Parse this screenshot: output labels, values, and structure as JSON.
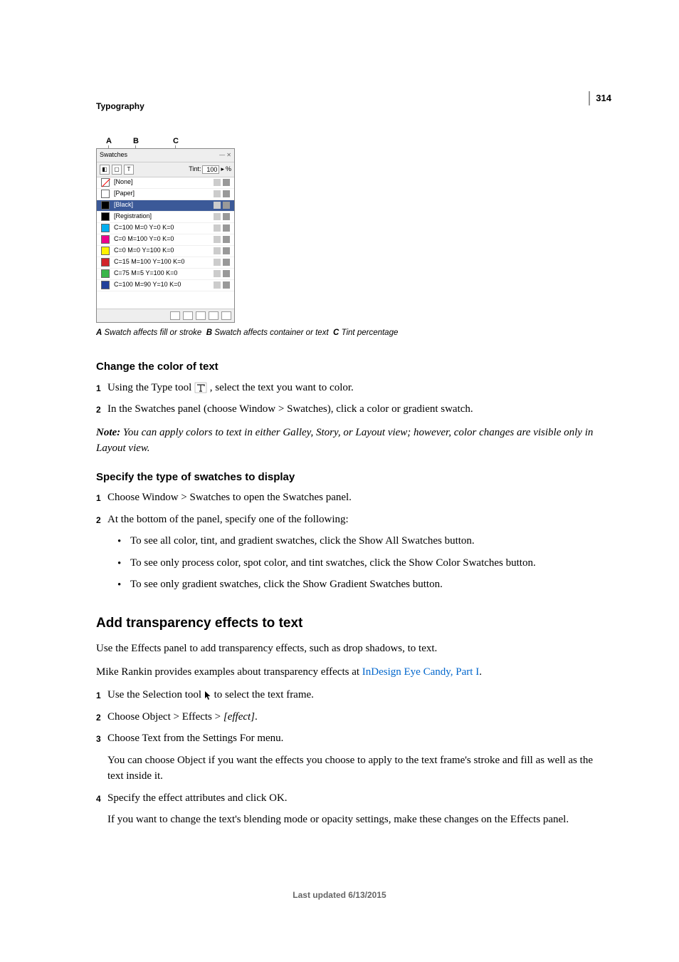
{
  "page_number": "314",
  "chapter": "Typography",
  "panel": {
    "labels": {
      "a": "A",
      "b": "B",
      "c": "C"
    },
    "tab": "Swatches",
    "tint_label": "Tint:",
    "tint_value": "100",
    "tint_unit": "%",
    "rows": [
      {
        "name": "[None]",
        "color": "transparent",
        "none": true,
        "sel": false
      },
      {
        "name": "[Paper]",
        "color": "#ffffff",
        "sel": false
      },
      {
        "name": "[Black]",
        "color": "#000000",
        "sel": true
      },
      {
        "name": "[Registration]",
        "color": "#000000",
        "sel": false
      },
      {
        "name": "C=100 M=0 Y=0 K=0",
        "color": "#00aeef",
        "sel": false
      },
      {
        "name": "C=0 M=100 Y=0 K=0",
        "color": "#ec008c",
        "sel": false
      },
      {
        "name": "C=0 M=0 Y=100 K=0",
        "color": "#fff200",
        "sel": false
      },
      {
        "name": "C=15 M=100 Y=100 K=0",
        "color": "#d2232a",
        "sel": false
      },
      {
        "name": "C=75 M=5 Y=100 K=0",
        "color": "#39b54a",
        "sel": false
      },
      {
        "name": "C=100 M=90 Y=10 K=0",
        "color": "#21409a",
        "sel": false
      }
    ]
  },
  "caption": {
    "a_label": "A",
    "a_text": "Swatch affects fill or stroke",
    "b_label": "B",
    "b_text": "Swatch affects container or text",
    "c_label": "C",
    "c_text": "Tint percentage"
  },
  "s1": {
    "heading": "Change the color of text",
    "step1_pre": "Using the Type tool ",
    "step1_post": " , select the text you want to color.",
    "step2": "In the Swatches panel (choose Window > Swatches), click a color or gradient swatch.",
    "note_label": "Note:",
    "note_body": " You can apply colors to text in either Galley, Story, or Layout view; however, color changes are visible only in Layout view."
  },
  "s2": {
    "heading": "Specify the type of swatches to display",
    "step1": "Choose Window > Swatches to open the Swatches panel.",
    "step2": "At the bottom of the panel, specify one of the following:",
    "bul1": "To see all color, tint, and gradient swatches, click the Show All Swatches button.",
    "bul2": "To see only process color, spot color, and tint swatches, click the Show Color Swatches button.",
    "bul3": "To see only gradient swatches, click the Show Gradient Swatches button."
  },
  "s3": {
    "heading": "Add transparency effects to text",
    "p1": "Use the Effects panel to add transparency effects, such as drop shadows, to text.",
    "p2_pre": "Mike Rankin provides examples about transparency effects at ",
    "p2_link": "InDesign Eye Candy, Part I",
    "p2_post": ".",
    "step1_pre": "Use the Selection tool ",
    "step1_post": " to select the text frame.",
    "step2_pre": "Choose Object > Effects > ",
    "step2_effect": "[effect]",
    "step2_post": ".",
    "step3": "Choose Text from the Settings For menu.",
    "step3_sub": "You can choose Object if you want the effects you choose to apply to the text frame's stroke and fill as well as the text inside it.",
    "step4": "Specify the effect attributes and click OK.",
    "step4_sub": "If you want to change the text's blending mode or opacity settings, make these changes on the Effects panel."
  },
  "footer": "Last updated 6/13/2015"
}
